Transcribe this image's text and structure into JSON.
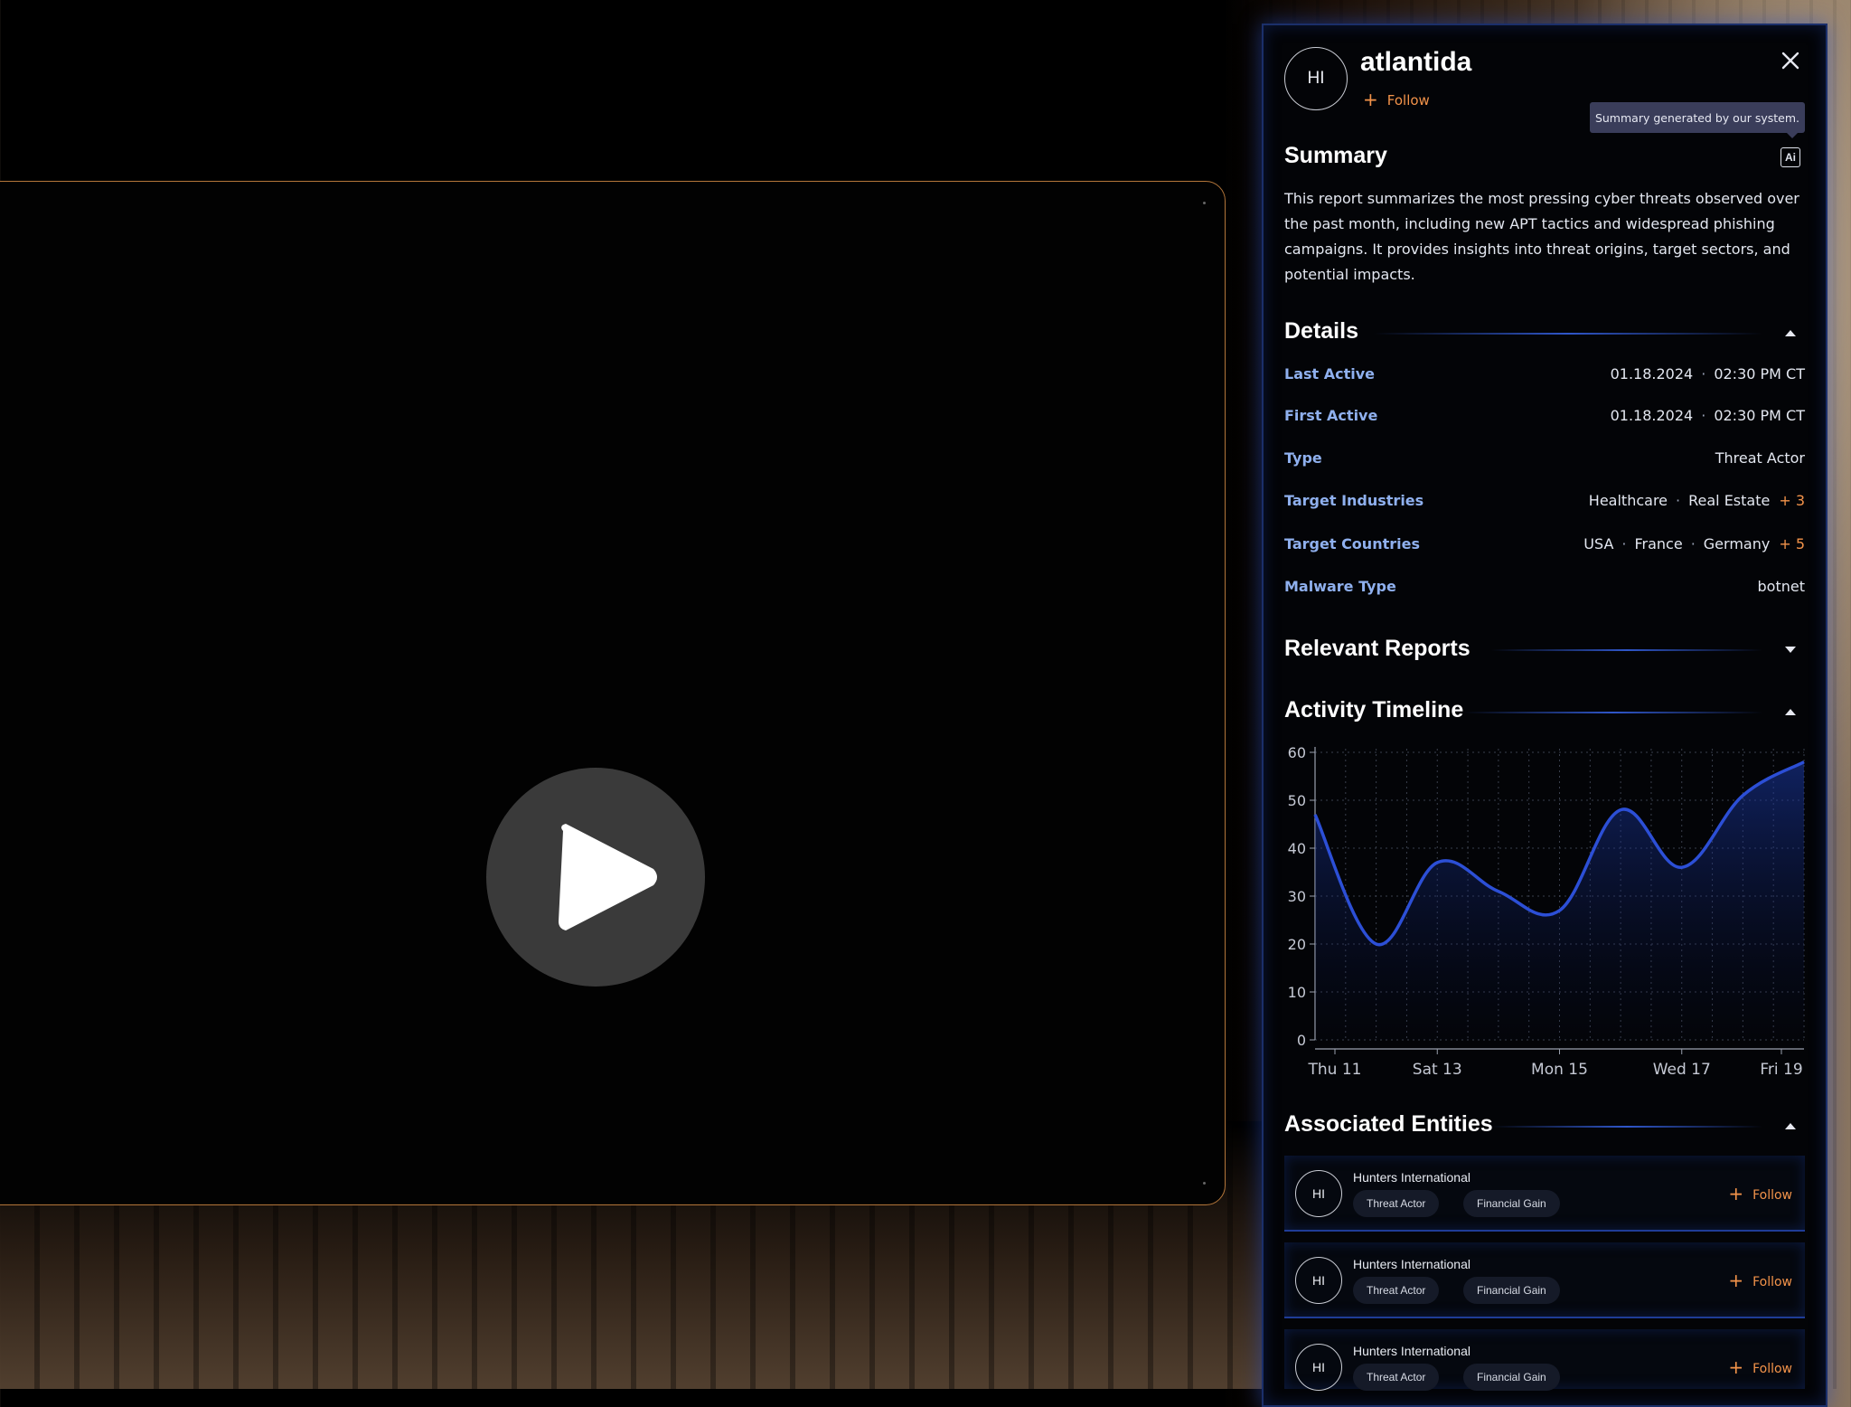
{
  "video": {
    "play_label": "Play"
  },
  "profile": {
    "avatar_initials": "HI",
    "name": "atlantida",
    "follow_label": "Follow"
  },
  "tooltip": "Summary generated by our system.",
  "summary": {
    "heading": "Summary",
    "ai_badge": "Ai",
    "text": "This report summarizes the most pressing cyber threats observed over the past month, including new APT tactics and widespread phishing campaigns. It provides insights into threat origins, target sectors, and potential impacts."
  },
  "details": {
    "heading": "Details",
    "last_active": {
      "label": "Last Active",
      "date": "01.18.2024",
      "time": "02:30 PM CT"
    },
    "first_active": {
      "label": "First Active",
      "date": "01.18.2024",
      "time": "02:30 PM CT"
    },
    "type": {
      "label": "Type",
      "value": "Threat Actor"
    },
    "target_industries": {
      "label": "Target Industries",
      "values": [
        "Healthcare",
        "Real Estate"
      ],
      "more": "+ 3"
    },
    "target_countries": {
      "label": "Target Countries",
      "values": [
        "USA",
        "France",
        "Germany"
      ],
      "more": "+ 5"
    },
    "malware_type": {
      "label": "Malware Type",
      "value": "botnet"
    }
  },
  "relevant_reports": {
    "heading": "Relevant Reports"
  },
  "activity_timeline": {
    "heading": "Activity Timeline"
  },
  "chart_data": {
    "type": "area",
    "title": "",
    "xlabel": "",
    "ylabel": "",
    "ylim": [
      0,
      60
    ],
    "yticks": [
      0,
      10,
      20,
      30,
      40,
      50,
      60
    ],
    "xtick_labels": [
      "Thu 11",
      "Sat 13",
      "Mon 15",
      "Wed 17",
      "Fri 19"
    ],
    "grid": true,
    "line_color": "#2c4fd6",
    "x": [
      "Thu 11",
      "Fri 12",
      "Sat 13",
      "Sun 14",
      "Mon 15",
      "Tue 16",
      "Wed 17",
      "Thu 18",
      "Fri 19"
    ],
    "series": [
      {
        "values": [
          47,
          20,
          37,
          31,
          27,
          48,
          36,
          51,
          58
        ]
      }
    ]
  },
  "associated_entities": {
    "heading": "Associated Entities",
    "items": [
      {
        "initials": "HI",
        "name": "Hunters International",
        "tags": [
          "Threat Actor",
          "Financial Gain"
        ],
        "follow": "Follow"
      },
      {
        "initials": "HI",
        "name": "Hunters International",
        "tags": [
          "Threat Actor",
          "Financial Gain"
        ],
        "follow": "Follow"
      },
      {
        "initials": "HI",
        "name": "Hunters International",
        "tags": [
          "Threat Actor",
          "Financial Gain"
        ],
        "follow": "Follow"
      }
    ]
  },
  "colors": {
    "accent": "#f3934a",
    "label_blue": "#8fb0ee",
    "panel_border": "#1b2f6a"
  }
}
